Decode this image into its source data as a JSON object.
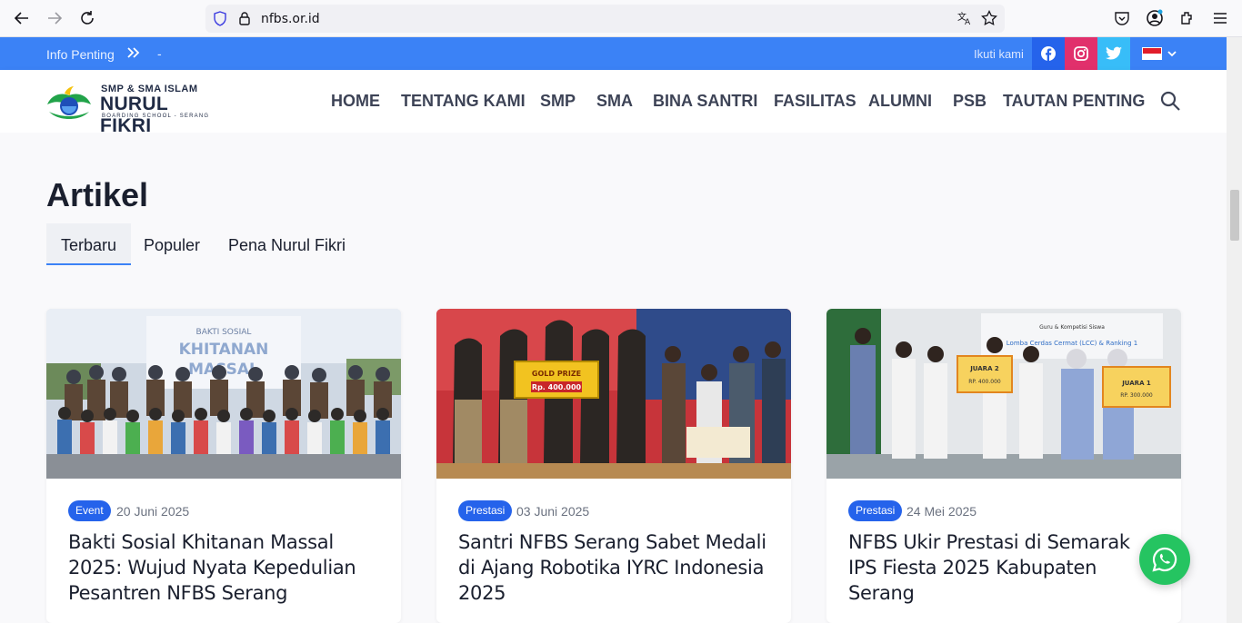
{
  "browser": {
    "url": "nfbs.or.id"
  },
  "info_bar": {
    "label": "Info Penting",
    "ticker": "-",
    "follow_label": "Ikuti kami"
  },
  "logo": {
    "line1": "SMP & SMA ISLAM",
    "line2": "NURUL FIKRI",
    "line3": "BOARDING SCHOOL - SERANG"
  },
  "menu": {
    "items": [
      "HOME",
      "TENTANG KAMI",
      "SMP",
      "SMA",
      "BINA SANTRI",
      "FASILITAS",
      "ALUMNI",
      "PSB",
      "TAUTAN PENTING"
    ]
  },
  "section": {
    "title": "Artikel",
    "tabs": [
      "Terbaru",
      "Populer",
      "Pena Nurul Fikri"
    ],
    "active_tab": "Terbaru"
  },
  "articles": [
    {
      "category": "Event",
      "date": "20 Juni 2025",
      "title": "Bakti Sosial Khitanan Massal 2025: Wujud Nyata Kepedulian Pesantren NFBS Serang",
      "image_banner": "BAKTI SOSIAL KHITANAN MASSAL"
    },
    {
      "category": "Prestasi",
      "date": "03 Juni 2025",
      "title": "Santri NFBS Serang Sabet Medali di Ajang Robotika IYRC Indonesia 2025",
      "image_banner": "GOLD PRIZE Rp. 400.000"
    },
    {
      "category": "Prestasi",
      "date": "24 Mei 2025",
      "title": "NFBS Ukir Prestasi di Semarak IPS Fiesta 2025 Kabupaten Serang",
      "image_banner": "JUARA 2 RP. 400.000 | JUARA 1 RP. 300.000"
    }
  ],
  "colors": {
    "accent": "#3b82f6",
    "badge": "#2563eb",
    "whatsapp": "#25c461",
    "instagram": "#e1306c",
    "twitter": "#38bdf8"
  }
}
